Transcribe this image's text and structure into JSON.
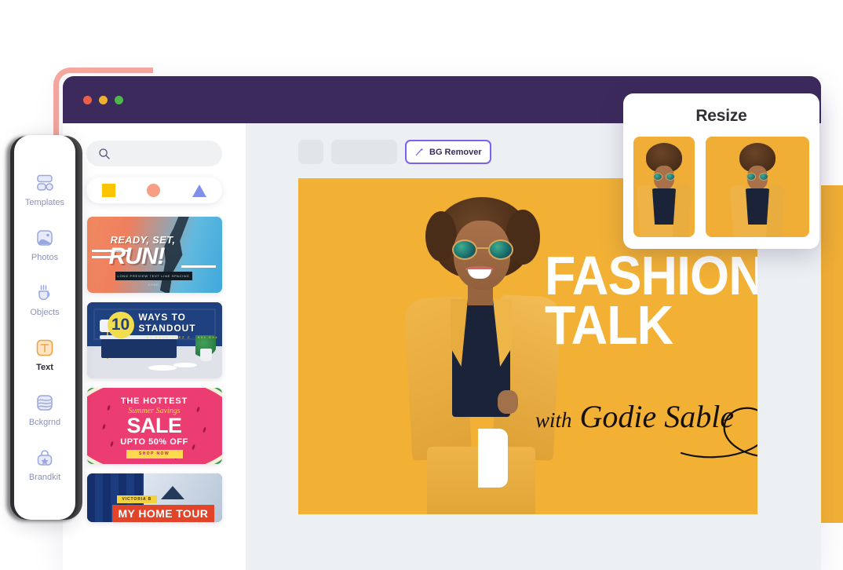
{
  "window": {
    "traffic_lights": [
      "close",
      "minimize",
      "maximize"
    ],
    "titlebar_color": "#3d2a5d"
  },
  "rail": {
    "items": [
      {
        "label": "Templates",
        "icon": "templates-icon",
        "active": false
      },
      {
        "label": "Photos",
        "icon": "photos-icon",
        "active": false
      },
      {
        "label": "Objects",
        "icon": "objects-icon",
        "active": false
      },
      {
        "label": "Text",
        "icon": "text-icon",
        "active": true
      },
      {
        "label": "Bckgrnd",
        "icon": "background-icon",
        "active": false
      },
      {
        "label": "Brandkit",
        "icon": "brandkit-icon",
        "active": false
      }
    ]
  },
  "search": {
    "placeholder": "",
    "value": "",
    "icon": "search-icon"
  },
  "shape_filters": [
    {
      "name": "square-filter",
      "color": "#fdc500"
    },
    {
      "name": "circle-filter",
      "color": "#f79f85"
    },
    {
      "name": "triangle-filter",
      "color": "#8190e8"
    }
  ],
  "templates": [
    {
      "id": "ready-set-run",
      "line1": "READY, SET,",
      "line2": "RUN!",
      "caption": "LONG PREVIEW TEXT LINE SPACING ZONE"
    },
    {
      "id": "ten-ways-to-standout",
      "number": "10",
      "line1": "WAYS TO",
      "line2": "STANDOUT",
      "caption": "BY RODRIGUEZ C  ·  S01 E04"
    },
    {
      "id": "hottest-summer-sale",
      "line1": "THE HOTTEST",
      "line2": "Summer Savings",
      "line3": "SALE",
      "line4": "UPTO 50% OFF",
      "cta": "SHOP NOW"
    },
    {
      "id": "my-home-tour",
      "tag": "VICTORIA B",
      "title": "MY HOME TOUR"
    }
  ],
  "toolbar": {
    "placeholder_small": "",
    "placeholder_large": "",
    "bg_remover_label": "BG Remover",
    "bg_remover_icon": "magic-wand-icon",
    "bg_remover_border": "#7b61ef",
    "cursor": "pointer-arrow"
  },
  "artboard": {
    "background": "#f2b135",
    "title_line1": "FASHION",
    "title_line2": "TALK",
    "subtitle_with": "with",
    "subtitle_name": "Godie Sable",
    "subject": "woman-in-yellow-suit-with-sunglasses"
  },
  "resize_panel": {
    "title": "Resize",
    "thumbnails": [
      {
        "name": "resize-thumbnail-portrait",
        "ratio": "portrait"
      },
      {
        "name": "resize-thumbnail-square",
        "ratio": "square"
      }
    ]
  },
  "decor": {
    "pink": "#f7a9a0",
    "yellow": "#f2b135"
  }
}
